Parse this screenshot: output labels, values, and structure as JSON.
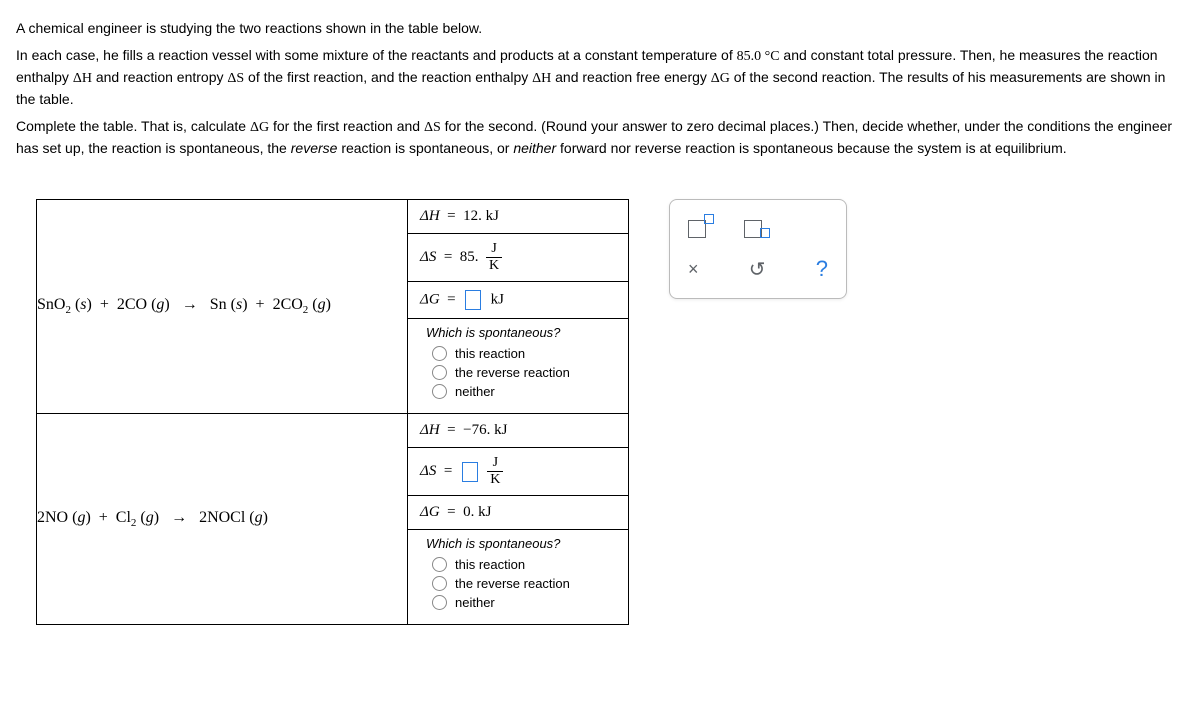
{
  "problem": {
    "p1": "A chemical engineer is studying the two reactions shown in the table below.",
    "p2a": "In each case, he fills a reaction vessel with some mixture of the reactants and products at a constant temperature of ",
    "p2_temp": "85.0 °C",
    "p2b": " and constant total pressure. Then, he measures the reaction enthalpy ",
    "dH": "ΔH",
    "p2c": " and reaction entropy ",
    "dS": "ΔS",
    "p2d": " of the first reaction, and the reaction enthalpy ",
    "p2e": " and reaction free energy ",
    "dG": "ΔG",
    "p2f": " of the second reaction. The results of his measurements are shown in the table.",
    "p3a": "Complete the table. That is, calculate ",
    "p3b": " for the first reaction and ",
    "p3c": " for the second. (Round your answer to zero decimal places.) Then, decide whether, under the conditions the engineer has set up, the reaction is spontaneous, the ",
    "p3_rev": "reverse",
    "p3d": " reaction is spontaneous, or ",
    "p3_neither": "neither",
    "p3e": " forward nor reverse reaction is spontaneous because the system is at equilibrium."
  },
  "reactions": [
    {
      "equation_html": "SnO<sub>2</sub>(<i>s</i>) + 2CO(<i>g</i>)  →  Sn(<i>s</i>) + 2CO<sub>2</sub>(<i>g</i>)",
      "dH": "ΔH =  12. kJ",
      "dS_prefix": "ΔS =  85. ",
      "dS_num": "J",
      "dS_den": "K",
      "dG_prefix": "ΔG = ",
      "dG_suffix": " kJ",
      "spont_q": "Which is spontaneous?",
      "opt1": "this reaction",
      "opt2": "the reverse reaction",
      "opt3": "neither"
    },
    {
      "equation_html": "2NO(<i>g</i>) + Cl<sub>2</sub>(<i>g</i>)  →  2NOCl(<i>g</i>)",
      "dH": "ΔH =  −76. kJ",
      "dS_prefix": "ΔS = ",
      "dS_num": "J",
      "dS_den": "K",
      "dG": "ΔG =  0. kJ",
      "spont_q": "Which is spontaneous?",
      "opt1": "this reaction",
      "opt2": "the reverse reaction",
      "opt3": "neither"
    }
  ],
  "tools": {
    "close": "×",
    "reset": "↺",
    "help": "?"
  }
}
